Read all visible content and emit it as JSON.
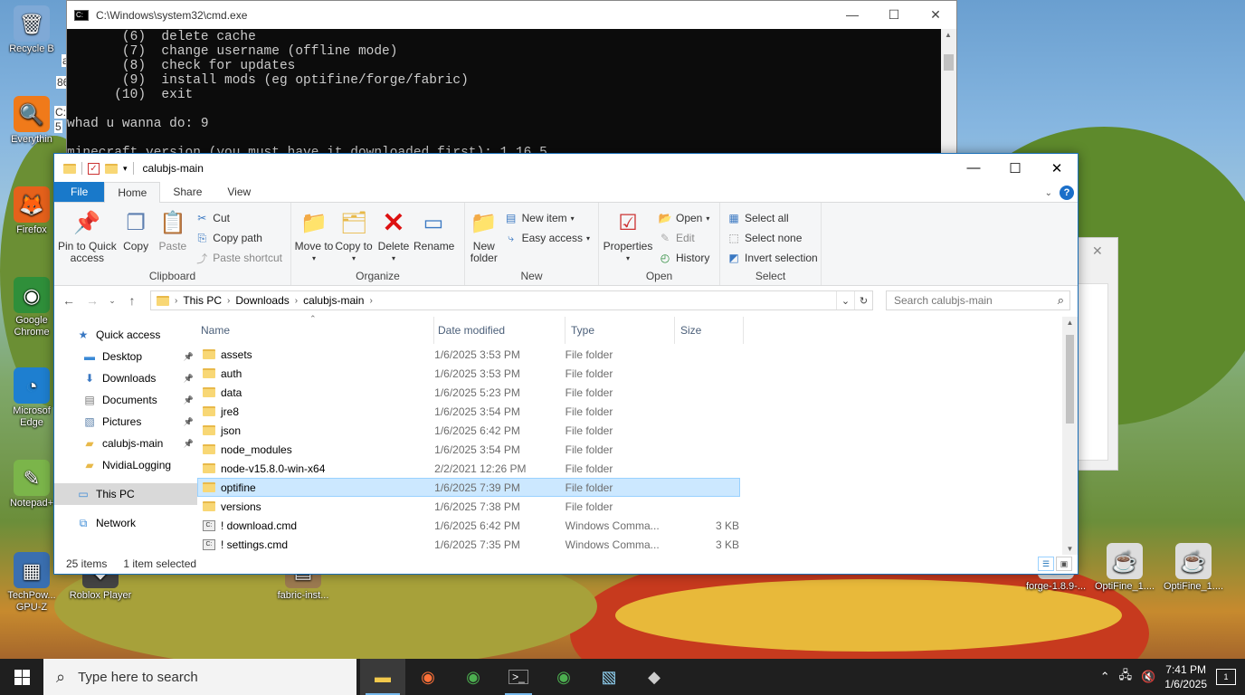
{
  "desktop": {
    "icons": [
      {
        "label": "Recycle B",
        "glyph": "🗑",
        "bg": "#7fa9d6"
      },
      {
        "label": "Everythin",
        "glyph": "🔍",
        "bg": "#f07a1a"
      },
      {
        "label": "Firefox",
        "glyph": "🦊",
        "bg": "#e5611b"
      },
      {
        "label": "Google Chrome",
        "glyph": "◉",
        "bg": "#2f8f3a"
      },
      {
        "label": "Microsof Edge",
        "glyph": "◔",
        "bg": "#1e7fd0"
      },
      {
        "label": "Notepad+",
        "glyph": "✎",
        "bg": "#7bb54a"
      },
      {
        "label": "TechPow... GPU-Z",
        "glyph": "▦",
        "bg": "#3a6fb0"
      },
      {
        "label": "Roblox Player",
        "glyph": "◆",
        "bg": "#444"
      },
      {
        "label": "fabric-inst...",
        "glyph": "▤",
        "bg": "#9c7a50"
      },
      {
        "label": "forge-1.8.9-...",
        "glyph": "☕",
        "bg": "#ddd"
      },
      {
        "label": "OptiFine_1....",
        "glyph": "☕",
        "bg": "#ddd"
      },
      {
        "label": "OptiFine_1....",
        "glyph": "☕",
        "bg": "#ddd"
      }
    ],
    "peek_texts": [
      "a",
      "86",
      "C:",
      "5"
    ]
  },
  "cmd": {
    "title": "C:\\Windows\\system32\\cmd.exe",
    "lines": [
      "       (6)  delete cache",
      "       (7)  change username (offline mode)",
      "       (8)  check for updates",
      "       (9)  install mods (eg optifine/forge/fabric)",
      "      (10)  exit",
      "",
      "whad u wanna do: 9",
      "",
      "minecraft version (you must have it downloaded first): 1.16.5"
    ]
  },
  "explorer": {
    "title": "calubjs-main",
    "window_controls": {
      "minimize": "—",
      "maximize": "☐",
      "close": "✕"
    },
    "tabs": [
      "File",
      "Home",
      "Share",
      "View"
    ],
    "ribbon": {
      "clipboard": {
        "name": "Clipboard",
        "pin": "Pin to Quick access",
        "copy": "Copy",
        "paste": "Paste",
        "cut": "Cut",
        "copy_path": "Copy path",
        "paste_shortcut": "Paste shortcut"
      },
      "organize": {
        "name": "Organize",
        "move_to": "Move to",
        "copy_to": "Copy to",
        "delete": "Delete",
        "rename": "Rename"
      },
      "new": {
        "name": "New",
        "new_folder": "New folder",
        "new_item": "New item",
        "easy_access": "Easy access"
      },
      "open": {
        "name": "Open",
        "properties": "Properties",
        "open": "Open",
        "edit": "Edit",
        "history": "History"
      },
      "select": {
        "name": "Select",
        "select_all": "Select all",
        "select_none": "Select none",
        "invert": "Invert selection"
      }
    },
    "address": {
      "crumbs": [
        "This PC",
        "Downloads",
        "calubjs-main"
      ],
      "search_placeholder": "Search calubjs-main"
    },
    "nav": [
      {
        "label": "Quick access",
        "icon": "star-icon",
        "pinned": false,
        "indent": 0
      },
      {
        "label": "Desktop",
        "icon": "desktop-icon",
        "pinned": true,
        "indent": 1
      },
      {
        "label": "Downloads",
        "icon": "download-icon",
        "pinned": true,
        "indent": 1
      },
      {
        "label": "Documents",
        "icon": "document-icon",
        "pinned": true,
        "indent": 1
      },
      {
        "label": "Pictures",
        "icon": "picture-icon",
        "pinned": true,
        "indent": 1
      },
      {
        "label": "calubjs-main",
        "icon": "folder-icon",
        "pinned": true,
        "indent": 1
      },
      {
        "label": "NvidiaLogging",
        "icon": "folder-icon",
        "pinned": false,
        "indent": 1
      },
      {
        "label": "This PC",
        "icon": "pc-icon",
        "pinned": false,
        "indent": 0,
        "selected": true
      },
      {
        "label": "Network",
        "icon": "network-icon",
        "pinned": false,
        "indent": 0
      }
    ],
    "columns": [
      "Name",
      "Date modified",
      "Type",
      "Size"
    ],
    "files": [
      {
        "name": "assets",
        "date": "1/6/2025 3:53 PM",
        "type": "File folder",
        "size": "",
        "kind": "folder"
      },
      {
        "name": "auth",
        "date": "1/6/2025 3:53 PM",
        "type": "File folder",
        "size": "",
        "kind": "folder"
      },
      {
        "name": "data",
        "date": "1/6/2025 5:23 PM",
        "type": "File folder",
        "size": "",
        "kind": "folder"
      },
      {
        "name": "jre8",
        "date": "1/6/2025 3:54 PM",
        "type": "File folder",
        "size": "",
        "kind": "folder"
      },
      {
        "name": "json",
        "date": "1/6/2025 6:42 PM",
        "type": "File folder",
        "size": "",
        "kind": "folder"
      },
      {
        "name": "node_modules",
        "date": "1/6/2025 3:54 PM",
        "type": "File folder",
        "size": "",
        "kind": "folder"
      },
      {
        "name": "node-v15.8.0-win-x64",
        "date": "2/2/2021 12:26 PM",
        "type": "File folder",
        "size": "",
        "kind": "folder"
      },
      {
        "name": "optifine",
        "date": "1/6/2025 7:39 PM",
        "type": "File folder",
        "size": "",
        "kind": "folder",
        "selected": true
      },
      {
        "name": "versions",
        "date": "1/6/2025 7:38 PM",
        "type": "File folder",
        "size": "",
        "kind": "folder"
      },
      {
        "name": "! download.cmd",
        "date": "1/6/2025 6:42 PM",
        "type": "Windows Comma...",
        "size": "3 KB",
        "kind": "cmd"
      },
      {
        "name": "! settings.cmd",
        "date": "1/6/2025 7:35 PM",
        "type": "Windows Comma...",
        "size": "3 KB",
        "kind": "cmd"
      }
    ],
    "status": {
      "items": "25 items",
      "selected": "1 item selected"
    }
  },
  "taskbar": {
    "search_placeholder": "Type here to search",
    "time": "7:41 PM",
    "date": "1/6/2025",
    "notifications": "1"
  }
}
